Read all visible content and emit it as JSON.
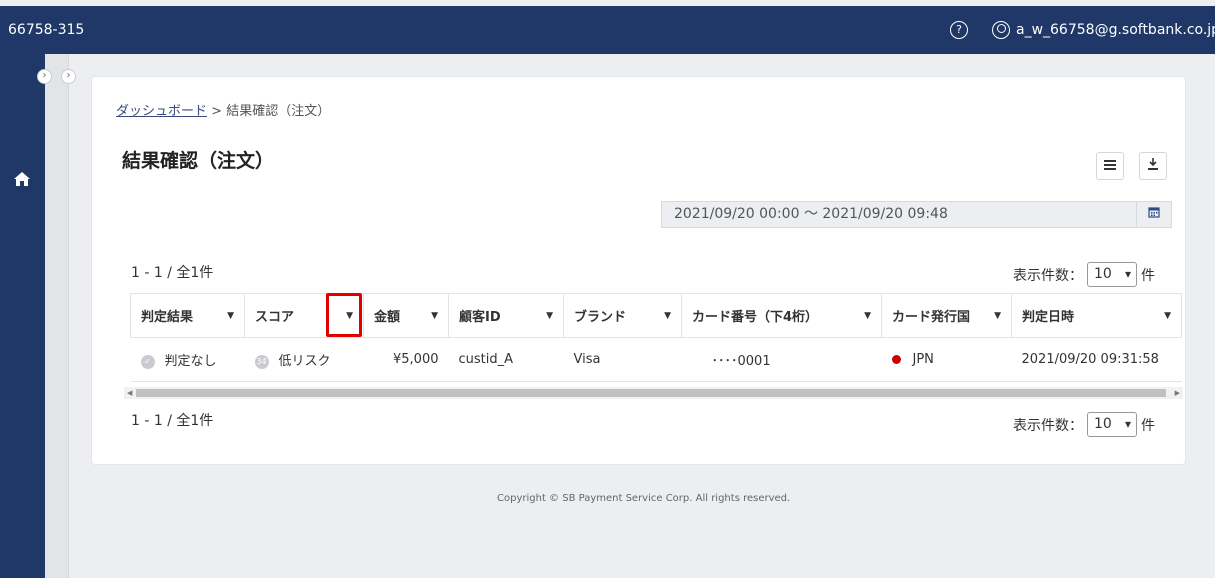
{
  "header": {
    "account_id": "66758-315",
    "help_icon": "?",
    "user_email": "a_w_66758@g.softbank.co.jp"
  },
  "breadcrumb": {
    "link": "ダッシュボード",
    "separator": ">",
    "current": "結果確認（注文）"
  },
  "page": {
    "title": "結果確認（注文）",
    "date_range": "2021/09/20 00:00 ～ 2021/09/20 09:48"
  },
  "pagination": {
    "count_text": "1 - 1 / 全1件",
    "per_page_label": "表示件数：",
    "per_page_value": "10",
    "per_page_unit": "件"
  },
  "table": {
    "headers": [
      "判定結果",
      "スコア",
      "金額",
      "顧客ID",
      "ブランド",
      "カード番号（下4桁）",
      "カード発行国",
      "判定日時"
    ],
    "rows": [
      {
        "judgement": "判定なし",
        "score_badge": "34",
        "score_label": "低リスク",
        "amount": "¥5,000",
        "customer_id": "custid_A",
        "brand": "Visa",
        "card_last4": "････0001",
        "country": "JPN",
        "judged_at": "2021/09/20 09:31:58"
      }
    ]
  },
  "footer": {
    "copyright": "Copyright © SB Payment Service Corp. All rights reserved."
  },
  "colors": {
    "nav": "#1f3867",
    "highlight": "#e00000",
    "country_dot": "#cc0000"
  }
}
